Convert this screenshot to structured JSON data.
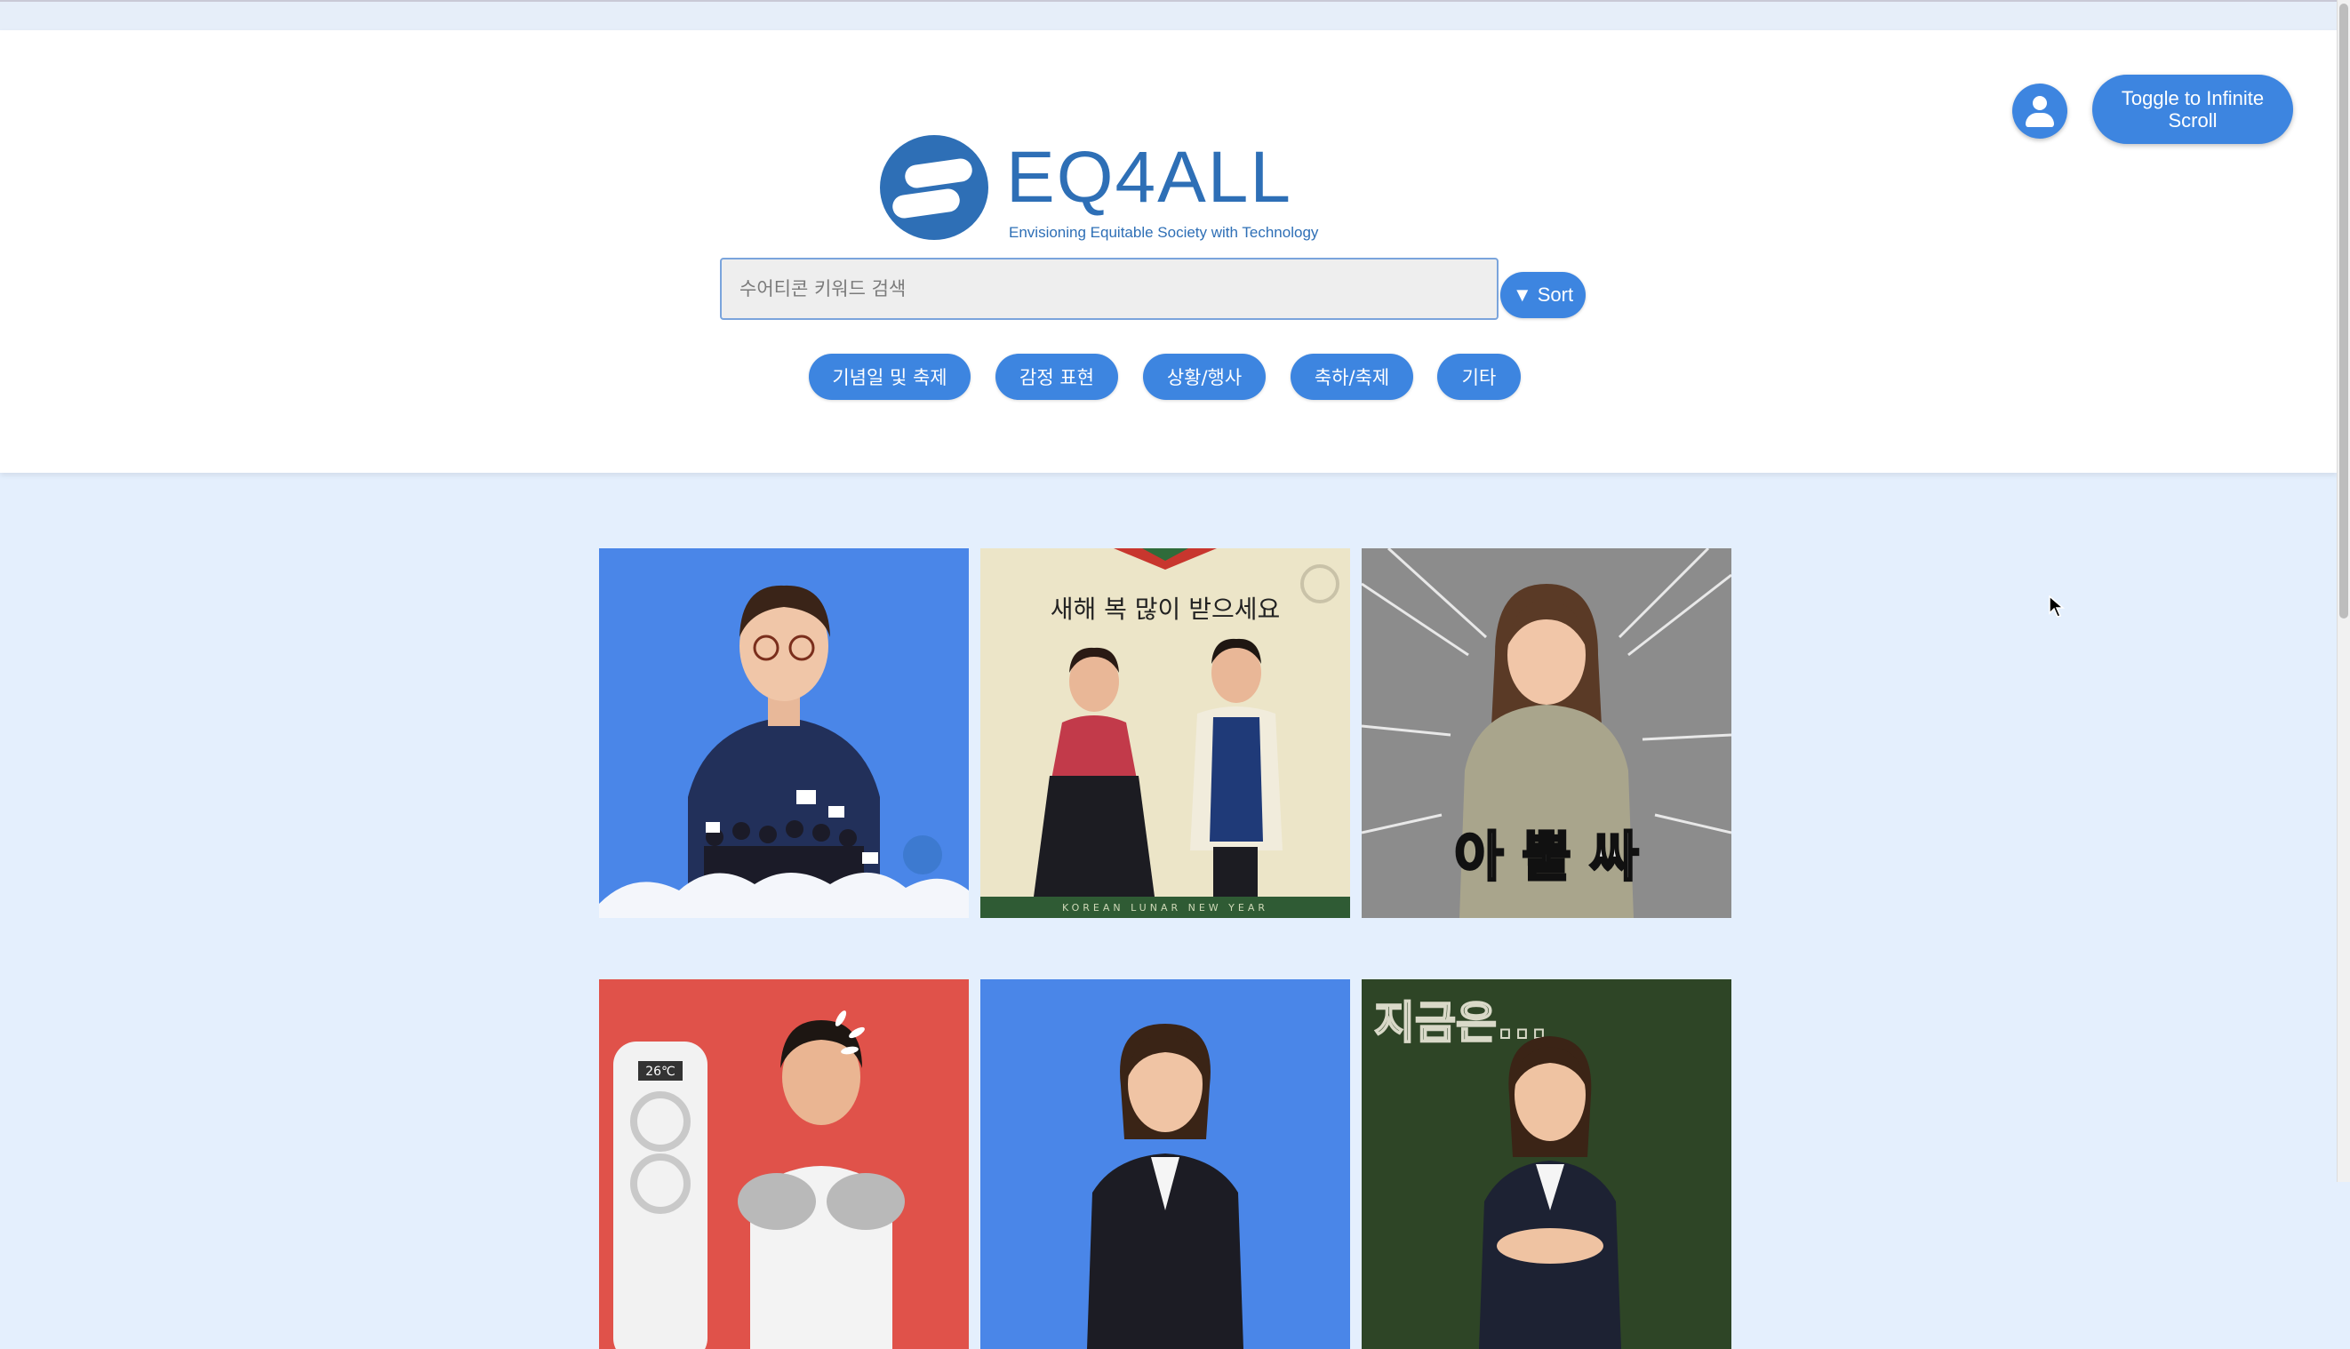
{
  "header": {
    "logo_text": "EQ4ALL",
    "logo_tagline": "Envisioning Equitable Society with Technology",
    "toggle_label": "Toggle to Infinite Scroll"
  },
  "search": {
    "placeholder": "수어티콘 키워드 검색",
    "sort_label": "▼ Sort"
  },
  "categories": [
    "기념일 및 축제",
    "감정 표현",
    "상황/행사",
    "축하/축제",
    "기타"
  ],
  "tiles": [
    {
      "bg": "#4a86e8",
      "caption": ""
    },
    {
      "bg": "#ece5c8",
      "caption": "새해 복 많이 받으세요",
      "footer": "KOREAN LUNAR NEW YEAR"
    },
    {
      "bg": "#8c8c8c",
      "caption": "아 뿔 싸"
    },
    {
      "bg": "#e0524a",
      "caption": "",
      "display": "26℃"
    },
    {
      "bg": "#4a86e8",
      "caption": ""
    },
    {
      "bg": "#2e4526",
      "caption": "지금은..."
    }
  ],
  "colors": {
    "accent": "#3d85e0",
    "brand": "#2e6fb6",
    "page_bg": "#e4effd"
  }
}
